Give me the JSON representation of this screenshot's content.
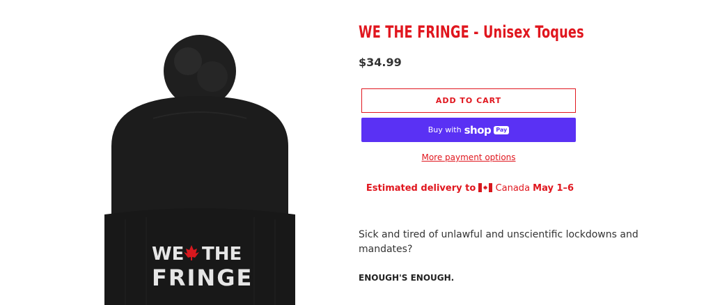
{
  "product": {
    "title": "WE THE FRINGE - Unisex Toques",
    "price": "$34.99",
    "image_alt": "black pom-pom toque",
    "embroidery": {
      "line1_left": "WE",
      "line1_right": "THE",
      "line2": "FRINGE"
    }
  },
  "buttons": {
    "add_to_cart": "ADD TO CART",
    "buy_with": "Buy with",
    "shop_word": "shop",
    "pay_badge": "Pay",
    "more_payment_options": "More payment options"
  },
  "delivery": {
    "prefix": "Estimated delivery to",
    "country": "Canada",
    "dates": "May 1–6"
  },
  "description": {
    "paragraph1": "Sick and tired of unlawful and unscientific lockdowns and mandates?",
    "paragraph2": "ENOUGH'S ENOUGH.",
    "paragraph3_partial": ""
  },
  "colors": {
    "accent_red": "#e0161e",
    "shop_pay_purple": "#5a31f4",
    "toque_black": "#1c1c1c"
  },
  "icons": [
    "canada-flag-icon",
    "maple-leaf-icon"
  ]
}
